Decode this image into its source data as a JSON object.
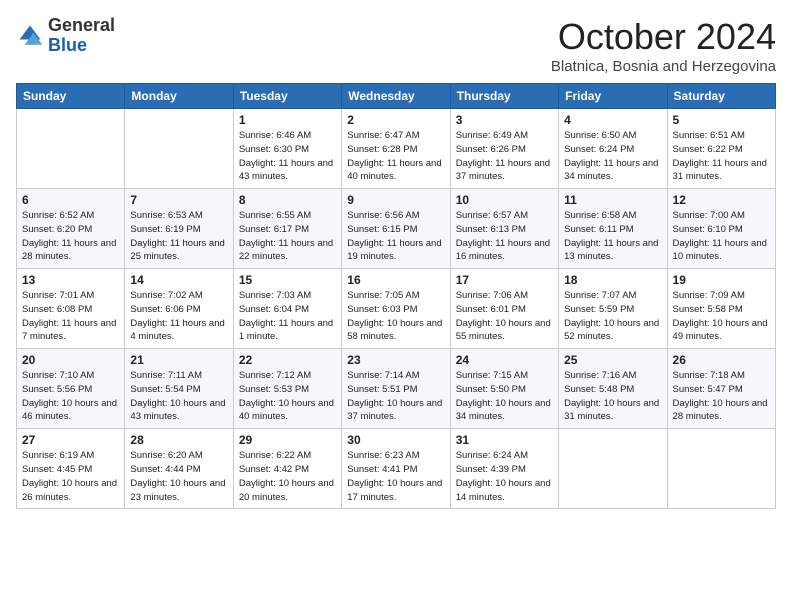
{
  "header": {
    "logo_general": "General",
    "logo_blue": "Blue",
    "month_title": "October 2024",
    "subtitle": "Blatnica, Bosnia and Herzegovina"
  },
  "days_of_week": [
    "Sunday",
    "Monday",
    "Tuesday",
    "Wednesday",
    "Thursday",
    "Friday",
    "Saturday"
  ],
  "weeks": [
    [
      {
        "day": "",
        "info": ""
      },
      {
        "day": "",
        "info": ""
      },
      {
        "day": "1",
        "info": "Sunrise: 6:46 AM\nSunset: 6:30 PM\nDaylight: 11 hours and 43 minutes."
      },
      {
        "day": "2",
        "info": "Sunrise: 6:47 AM\nSunset: 6:28 PM\nDaylight: 11 hours and 40 minutes."
      },
      {
        "day": "3",
        "info": "Sunrise: 6:49 AM\nSunset: 6:26 PM\nDaylight: 11 hours and 37 minutes."
      },
      {
        "day": "4",
        "info": "Sunrise: 6:50 AM\nSunset: 6:24 PM\nDaylight: 11 hours and 34 minutes."
      },
      {
        "day": "5",
        "info": "Sunrise: 6:51 AM\nSunset: 6:22 PM\nDaylight: 11 hours and 31 minutes."
      }
    ],
    [
      {
        "day": "6",
        "info": "Sunrise: 6:52 AM\nSunset: 6:20 PM\nDaylight: 11 hours and 28 minutes."
      },
      {
        "day": "7",
        "info": "Sunrise: 6:53 AM\nSunset: 6:19 PM\nDaylight: 11 hours and 25 minutes."
      },
      {
        "day": "8",
        "info": "Sunrise: 6:55 AM\nSunset: 6:17 PM\nDaylight: 11 hours and 22 minutes."
      },
      {
        "day": "9",
        "info": "Sunrise: 6:56 AM\nSunset: 6:15 PM\nDaylight: 11 hours and 19 minutes."
      },
      {
        "day": "10",
        "info": "Sunrise: 6:57 AM\nSunset: 6:13 PM\nDaylight: 11 hours and 16 minutes."
      },
      {
        "day": "11",
        "info": "Sunrise: 6:58 AM\nSunset: 6:11 PM\nDaylight: 11 hours and 13 minutes."
      },
      {
        "day": "12",
        "info": "Sunrise: 7:00 AM\nSunset: 6:10 PM\nDaylight: 11 hours and 10 minutes."
      }
    ],
    [
      {
        "day": "13",
        "info": "Sunrise: 7:01 AM\nSunset: 6:08 PM\nDaylight: 11 hours and 7 minutes."
      },
      {
        "day": "14",
        "info": "Sunrise: 7:02 AM\nSunset: 6:06 PM\nDaylight: 11 hours and 4 minutes."
      },
      {
        "day": "15",
        "info": "Sunrise: 7:03 AM\nSunset: 6:04 PM\nDaylight: 11 hours and 1 minute."
      },
      {
        "day": "16",
        "info": "Sunrise: 7:05 AM\nSunset: 6:03 PM\nDaylight: 10 hours and 58 minutes."
      },
      {
        "day": "17",
        "info": "Sunrise: 7:06 AM\nSunset: 6:01 PM\nDaylight: 10 hours and 55 minutes."
      },
      {
        "day": "18",
        "info": "Sunrise: 7:07 AM\nSunset: 5:59 PM\nDaylight: 10 hours and 52 minutes."
      },
      {
        "day": "19",
        "info": "Sunrise: 7:09 AM\nSunset: 5:58 PM\nDaylight: 10 hours and 49 minutes."
      }
    ],
    [
      {
        "day": "20",
        "info": "Sunrise: 7:10 AM\nSunset: 5:56 PM\nDaylight: 10 hours and 46 minutes."
      },
      {
        "day": "21",
        "info": "Sunrise: 7:11 AM\nSunset: 5:54 PM\nDaylight: 10 hours and 43 minutes."
      },
      {
        "day": "22",
        "info": "Sunrise: 7:12 AM\nSunset: 5:53 PM\nDaylight: 10 hours and 40 minutes."
      },
      {
        "day": "23",
        "info": "Sunrise: 7:14 AM\nSunset: 5:51 PM\nDaylight: 10 hours and 37 minutes."
      },
      {
        "day": "24",
        "info": "Sunrise: 7:15 AM\nSunset: 5:50 PM\nDaylight: 10 hours and 34 minutes."
      },
      {
        "day": "25",
        "info": "Sunrise: 7:16 AM\nSunset: 5:48 PM\nDaylight: 10 hours and 31 minutes."
      },
      {
        "day": "26",
        "info": "Sunrise: 7:18 AM\nSunset: 5:47 PM\nDaylight: 10 hours and 28 minutes."
      }
    ],
    [
      {
        "day": "27",
        "info": "Sunrise: 6:19 AM\nSunset: 4:45 PM\nDaylight: 10 hours and 26 minutes."
      },
      {
        "day": "28",
        "info": "Sunrise: 6:20 AM\nSunset: 4:44 PM\nDaylight: 10 hours and 23 minutes."
      },
      {
        "day": "29",
        "info": "Sunrise: 6:22 AM\nSunset: 4:42 PM\nDaylight: 10 hours and 20 minutes."
      },
      {
        "day": "30",
        "info": "Sunrise: 6:23 AM\nSunset: 4:41 PM\nDaylight: 10 hours and 17 minutes."
      },
      {
        "day": "31",
        "info": "Sunrise: 6:24 AM\nSunset: 4:39 PM\nDaylight: 10 hours and 14 minutes."
      },
      {
        "day": "",
        "info": ""
      },
      {
        "day": "",
        "info": ""
      }
    ]
  ]
}
